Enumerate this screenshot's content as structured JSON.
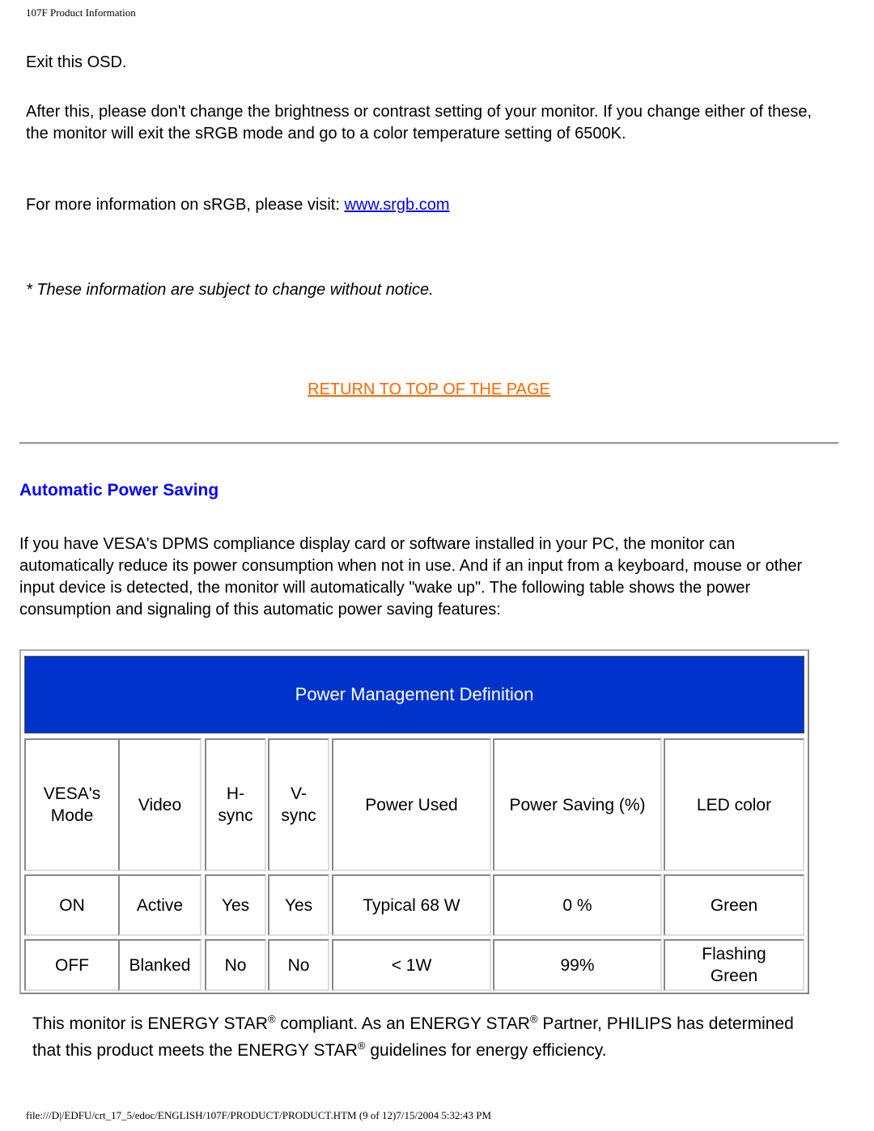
{
  "header": {
    "title": "107F Product Information"
  },
  "srgb": {
    "exit_text": "Exit this OSD.",
    "warning_text": "After this, please don't change the brightness or contrast setting of your monitor. If you change either of these, the monitor will exit the sRGB mode and go to a color temperature setting of 6500K.",
    "more_info_prefix": "For more information on sRGB, please visit: ",
    "more_info_link": "www.srgb.com",
    "notice": "* These information are subject to change without notice."
  },
  "return_link": "RETURN TO TOP OF THE PAGE",
  "section": {
    "title": "Automatic Power Saving",
    "intro": "If you have VESA's DPMS compliance display card or software installed in your PC, the monitor can automatically reduce its power consumption when not in use. And if an input from a keyboard, mouse or other input device is detected, the monitor will automatically \"wake up\". The following table shows the power consumption and signaling of this automatic power saving features:"
  },
  "table": {
    "title": "Power Management Definition",
    "headers": [
      "VESA's Mode",
      "Video",
      "H- sync",
      "V- sync",
      "Power Used",
      "Power Saving (%)",
      "LED color"
    ],
    "rows": [
      [
        "ON",
        "Active",
        "Yes",
        "Yes",
        "Typical 68 W",
        "0 %",
        "Green"
      ],
      [
        "OFF",
        "Blanked",
        "No",
        "No",
        "< 1W",
        "99%",
        "Flashing Green"
      ]
    ]
  },
  "energy_star": {
    "p1": "This monitor is ENERGY STAR",
    "p2": " compliant. As an ENERGY STAR",
    "p3": " Partner, PHILIPS has determined that this product meets the ENERGY STAR",
    "p4": " guidelines for energy efficiency.",
    "reg": "®"
  },
  "footer": {
    "path": "file:///D|/EDFU/crt_17_5/edoc/ENGLISH/107F/PRODUCT/PRODUCT.HTM (9 of 12)7/15/2004 5:32:43 PM"
  },
  "colors": {
    "table_header_bg": "#0033cc",
    "return_link": "#ff6600",
    "section_title": "#0000ff",
    "link": "#0000ee"
  }
}
